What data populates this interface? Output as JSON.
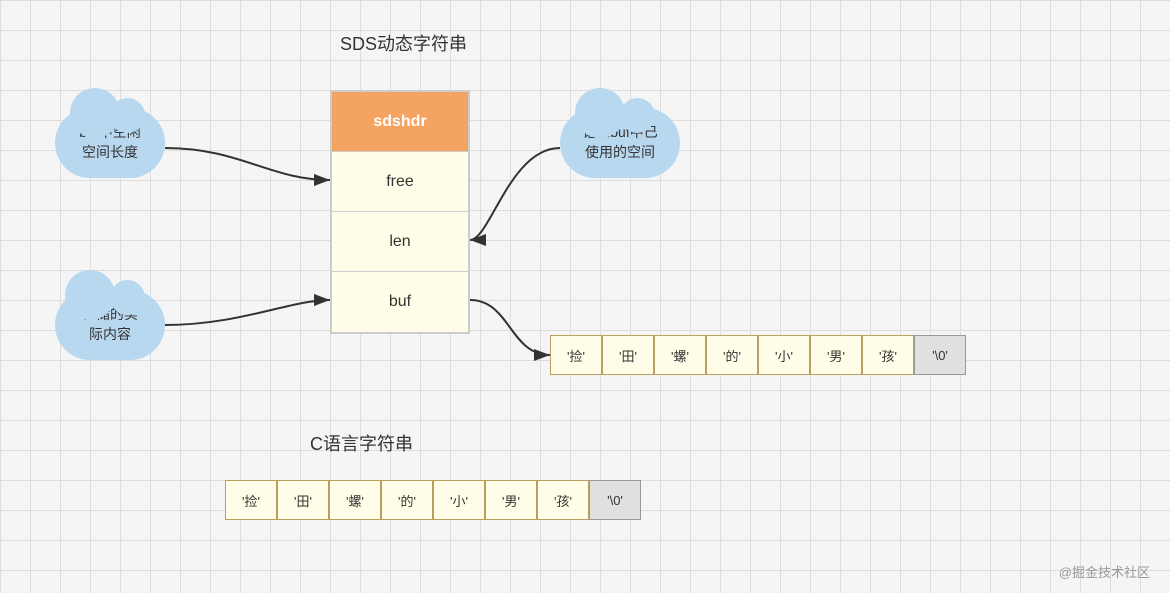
{
  "title_sds": "SDS动态字符串",
  "title_c": "C语言字符串",
  "cloud_buf_free": "buf中空闲\n空间长度",
  "cloud_record": "记录buf中已\n使用的空间",
  "cloud_storage": "存储的实\n际内容",
  "sds_rows": [
    {
      "label": "sdshdr",
      "class": "sds-row-sdshdr"
    },
    {
      "label": "free",
      "class": "sds-row-free"
    },
    {
      "label": "len",
      "class": "sds-row-len"
    },
    {
      "label": "buf",
      "class": "sds-row-buf"
    }
  ],
  "sds_chars": [
    "'捡'",
    "'田'",
    "'螺'",
    "'的'",
    "'小'",
    "'男'",
    "'孩'",
    "'\\0'"
  ],
  "c_chars": [
    "'捡'",
    "'田'",
    "'螺'",
    "'的'",
    "'小'",
    "'男'",
    "'孩'",
    "'\\0'"
  ],
  "watermark": "@掘金技术社区"
}
